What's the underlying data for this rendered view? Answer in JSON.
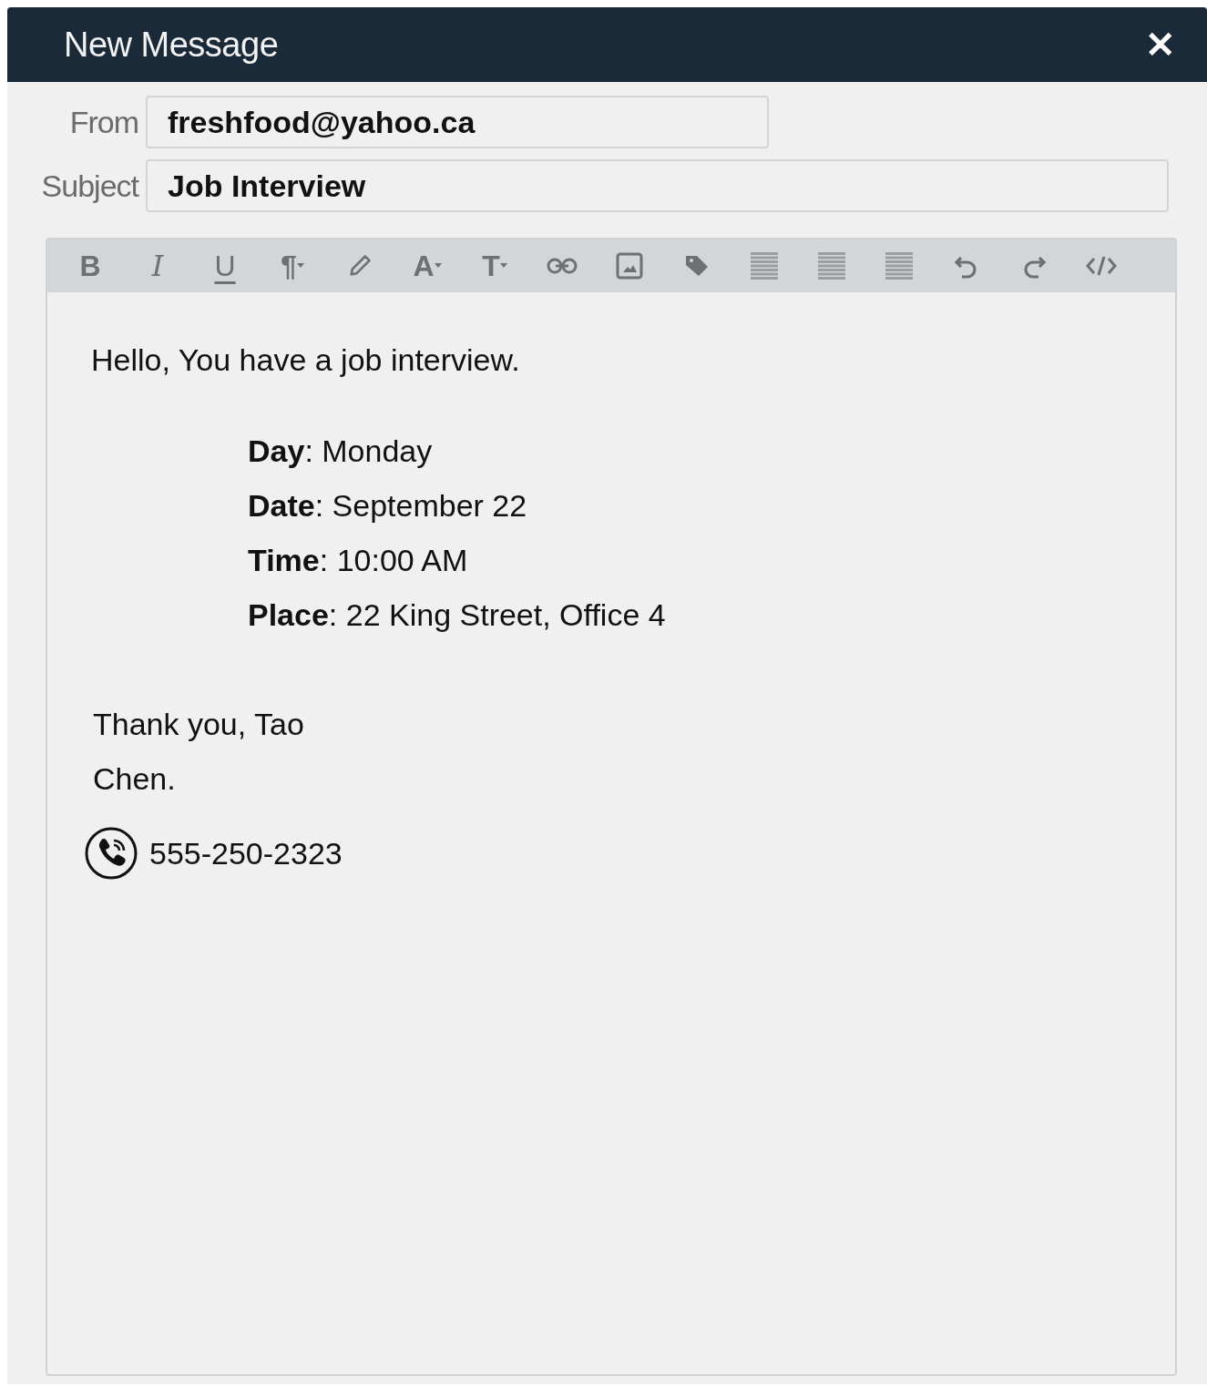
{
  "window": {
    "title": "New Message",
    "close": "✕"
  },
  "fields": [
    {
      "label": "From",
      "value": "freshfood@yahoo.ca",
      "kind": "short"
    },
    {
      "label": "Subject",
      "value": "Job Interview",
      "kind": "wide"
    }
  ],
  "toolbar": [
    {
      "kind": "bold",
      "label": "B"
    },
    {
      "kind": "italic",
      "label": "I"
    },
    {
      "kind": "underline",
      "label": "U"
    },
    {
      "kind": "dropdown",
      "label": "¶"
    },
    {
      "kind": "pen"
    },
    {
      "kind": "dropdown",
      "label": "A"
    },
    {
      "kind": "dropdown",
      "label": "T"
    },
    {
      "kind": "link"
    },
    {
      "kind": "image"
    },
    {
      "kind": "tag"
    },
    {
      "kind": "align-left"
    },
    {
      "kind": "align-center"
    },
    {
      "kind": "align-right"
    },
    {
      "kind": "undo"
    },
    {
      "kind": "redo"
    },
    {
      "kind": "code"
    }
  ],
  "body": {
    "greeting": "Hello, You have a job interview.",
    "details": [
      "**Day**: Monday",
      "**Date**: September 22",
      "**Time**: 10:00 AM",
      "**Place**: 22 King Street, Office 4"
    ],
    "closing": [
      "Thank you, Tao",
      "Chen."
    ],
    "phone": "555-250-2323"
  }
}
